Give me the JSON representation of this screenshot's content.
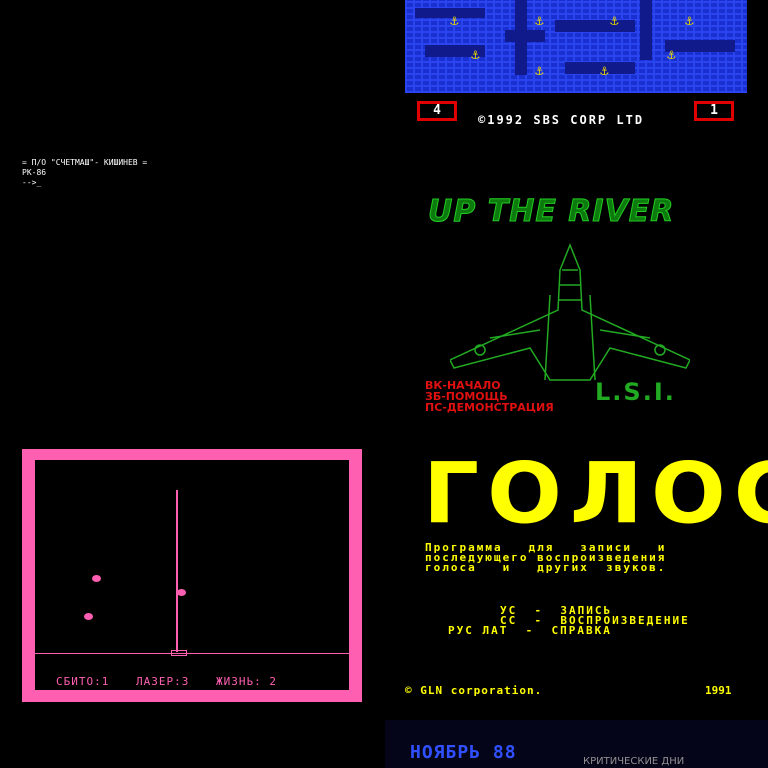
{
  "maze_game": {
    "lives": "4",
    "level": "1",
    "copyright": "©1992 SBS CORP LTD",
    "anchor_icon": "anchor-icon",
    "colors": {
      "background": "#1a2fd0",
      "counter_border": "#e00000",
      "anchors": "#e8d800"
    }
  },
  "terminal": {
    "line1": "= П/О \"СЧЕТМАШ\"- КИШИНЕВ =",
    "line2": "РК-86",
    "line3": "-->_"
  },
  "up_the_river": {
    "title": "UP THE RIVER",
    "menu": [
      "ВК-НАЧАЛО",
      "ЗБ-ПОМОЩЬ",
      "ПС-ДЕМОНСТРАЦИЯ"
    ],
    "logo": "L.S.I.",
    "colors": {
      "title": "#22cc22",
      "menu": "#e01010"
    }
  },
  "laser_game": {
    "shot_down": "СБИТО:1",
    "lasers": "ЛАЗЕР:3",
    "lives": "ЖИЗНЬ: 2",
    "colors": {
      "frame": "#ff5fb0"
    }
  },
  "golos": {
    "title": "ГОЛОС",
    "description": [
      "Программа   для   записи   и",
      "последующего воспроизведения",
      "голоса   и   других  звуков."
    ],
    "keys": [
      "УС  -  ЗАПИСЬ",
      "СС  -  ВОСПРОИЗВЕДЕНИЕ",
      "РУС ЛАТ  -  СПРАВКА"
    ],
    "copyright": "© GLN corporation.",
    "year": "1991",
    "colors": {
      "text": "#ffff00"
    }
  },
  "november": {
    "title": "НОЯБРЬ 88",
    "subtitle": "КРИТИЧЕСКИЕ ДНИ"
  }
}
